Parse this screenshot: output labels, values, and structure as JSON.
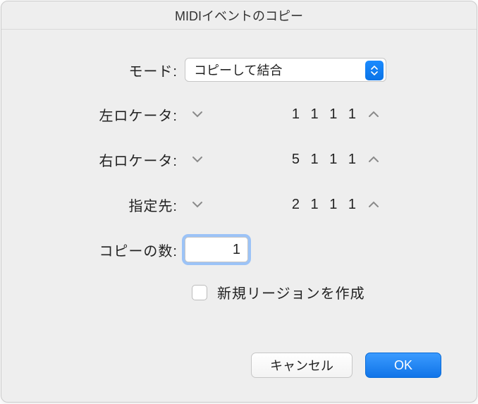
{
  "title": "MIDIイベントのコピー",
  "labels": {
    "mode": "モード:",
    "leftLocator": "左ロケータ:",
    "rightLocator": "右ロケータ:",
    "destination": "指定先:",
    "copies": "コピーの数:"
  },
  "mode": {
    "selected": "コピーして結合"
  },
  "leftLocator": {
    "value": "1 1 1    1"
  },
  "rightLocator": {
    "value": "5 1 1    1"
  },
  "destination": {
    "value": "2 1 1    1"
  },
  "copies": {
    "value": "1"
  },
  "checkbox": {
    "label": "新規リージョンを作成",
    "checked": false
  },
  "footer": {
    "cancel": "キャンセル",
    "ok": "OK"
  }
}
